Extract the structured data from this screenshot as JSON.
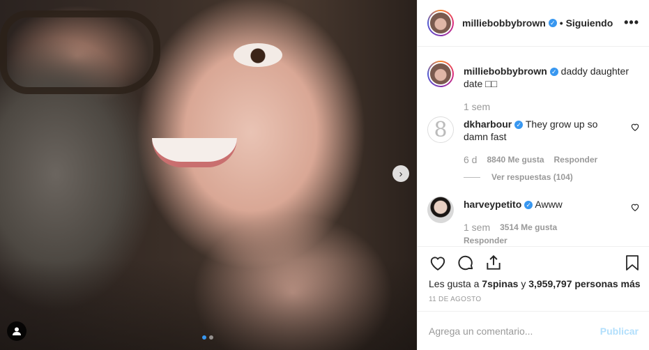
{
  "header": {
    "username": "milliebobbybrown",
    "separator": "•",
    "follow_label": "Siguiendo",
    "more_icon": "more-horizontal-icon"
  },
  "caption": {
    "username": "milliebobbybrown",
    "text": "daddy daughter date □□",
    "time": "1 sem"
  },
  "comments": [
    {
      "username": "dkharbour",
      "text": "They grow up so damn fast",
      "time": "6 d",
      "likes": "8840 Me gusta",
      "reply_label": "Responder",
      "view_replies": "Ver respuestas (104)"
    },
    {
      "username": "harveypetito",
      "text": "Awww",
      "time": "1 sem",
      "likes": "3514 Me gusta",
      "reply_label": "Responder"
    }
  ],
  "likes": {
    "prefix": "Les gusta a",
    "user": "7spinas",
    "middle": "y",
    "count": "3,959,797 personas más"
  },
  "date": "11 DE AGOSTO",
  "add_comment": {
    "placeholder": "Agrega un comentario...",
    "publish_label": "Publicar"
  },
  "carousel": {
    "slides": 2,
    "current": 1
  },
  "colors": {
    "accent": "#3897f0",
    "publish_disabled": "#b2dffc"
  }
}
